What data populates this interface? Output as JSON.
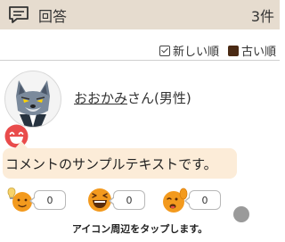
{
  "header": {
    "title": "回答",
    "count": "3件",
    "icon": "chat-icon"
  },
  "sort": {
    "new_label": "新しい順",
    "old_label": "古い順",
    "selected": "new"
  },
  "comment": {
    "username": "おおかみ",
    "suffix": "さん(男性)",
    "text": "コメントのサンプルテキストです。",
    "avatar": "wolf-avatar",
    "badge": "laughing-face-icon"
  },
  "reactions": [
    {
      "icon": "lightbulb-idea-icon",
      "count": "0"
    },
    {
      "icon": "laughing-face-icon",
      "count": "0"
    },
    {
      "icon": "cheering-face-icon",
      "count": "0"
    }
  ],
  "hint": "アイコン周辺をタップします。",
  "colors": {
    "header_bg": "#e6dccf",
    "bubble_bg": "#fcecd8",
    "accent_red": "#e94b4b",
    "emoji_orange": "#f39a1e",
    "checkbox_fill": "#4a2a14"
  }
}
